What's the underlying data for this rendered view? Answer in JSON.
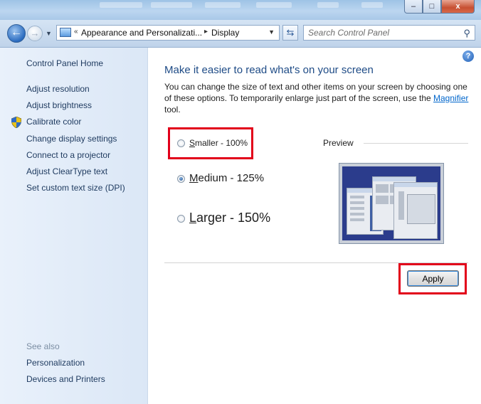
{
  "window": {
    "min_glyph": "‒",
    "max_glyph": "□",
    "close_glyph": "x"
  },
  "nav": {
    "breadcrumb_sep": "«",
    "crumbs": [
      "Appearance and Personalizati...",
      "Display"
    ],
    "crumb_arrow": "▸",
    "search_placeholder": "Search Control Panel"
  },
  "sidebar": {
    "home": "Control Panel Home",
    "items": [
      "Adjust resolution",
      "Adjust brightness",
      "Calibrate color",
      "Change display settings",
      "Connect to a projector",
      "Adjust ClearType text",
      "Set custom text size (DPI)"
    ],
    "see_also_label": "See also",
    "see_also": [
      "Personalization",
      "Devices and Printers"
    ]
  },
  "main": {
    "heading": "Make it easier to read what's on your screen",
    "description": "You can change the size of text and other items on your screen by choosing one of these options. To temporarily enlarge just part of the screen, use the",
    "magnifier_link": "Magnifier",
    "description_end": " tool.",
    "options": [
      {
        "first": "S",
        "rest": "maller - 100%",
        "checked": false
      },
      {
        "first": "M",
        "rest": "edium - 125%",
        "checked": true
      },
      {
        "first": "L",
        "rest": "arger - 150%",
        "checked": false
      }
    ],
    "preview_label": "Preview",
    "apply_label": "Apply",
    "help_glyph": "?"
  },
  "colors": {
    "highlight_box": "#e2001a",
    "heading": "#1e4b86",
    "link": "#0066cc"
  },
  "icons": [
    "back-icon",
    "forward-icon",
    "control-panel-icon",
    "refresh-icon",
    "search-icon",
    "shield-icon",
    "help-icon"
  ]
}
